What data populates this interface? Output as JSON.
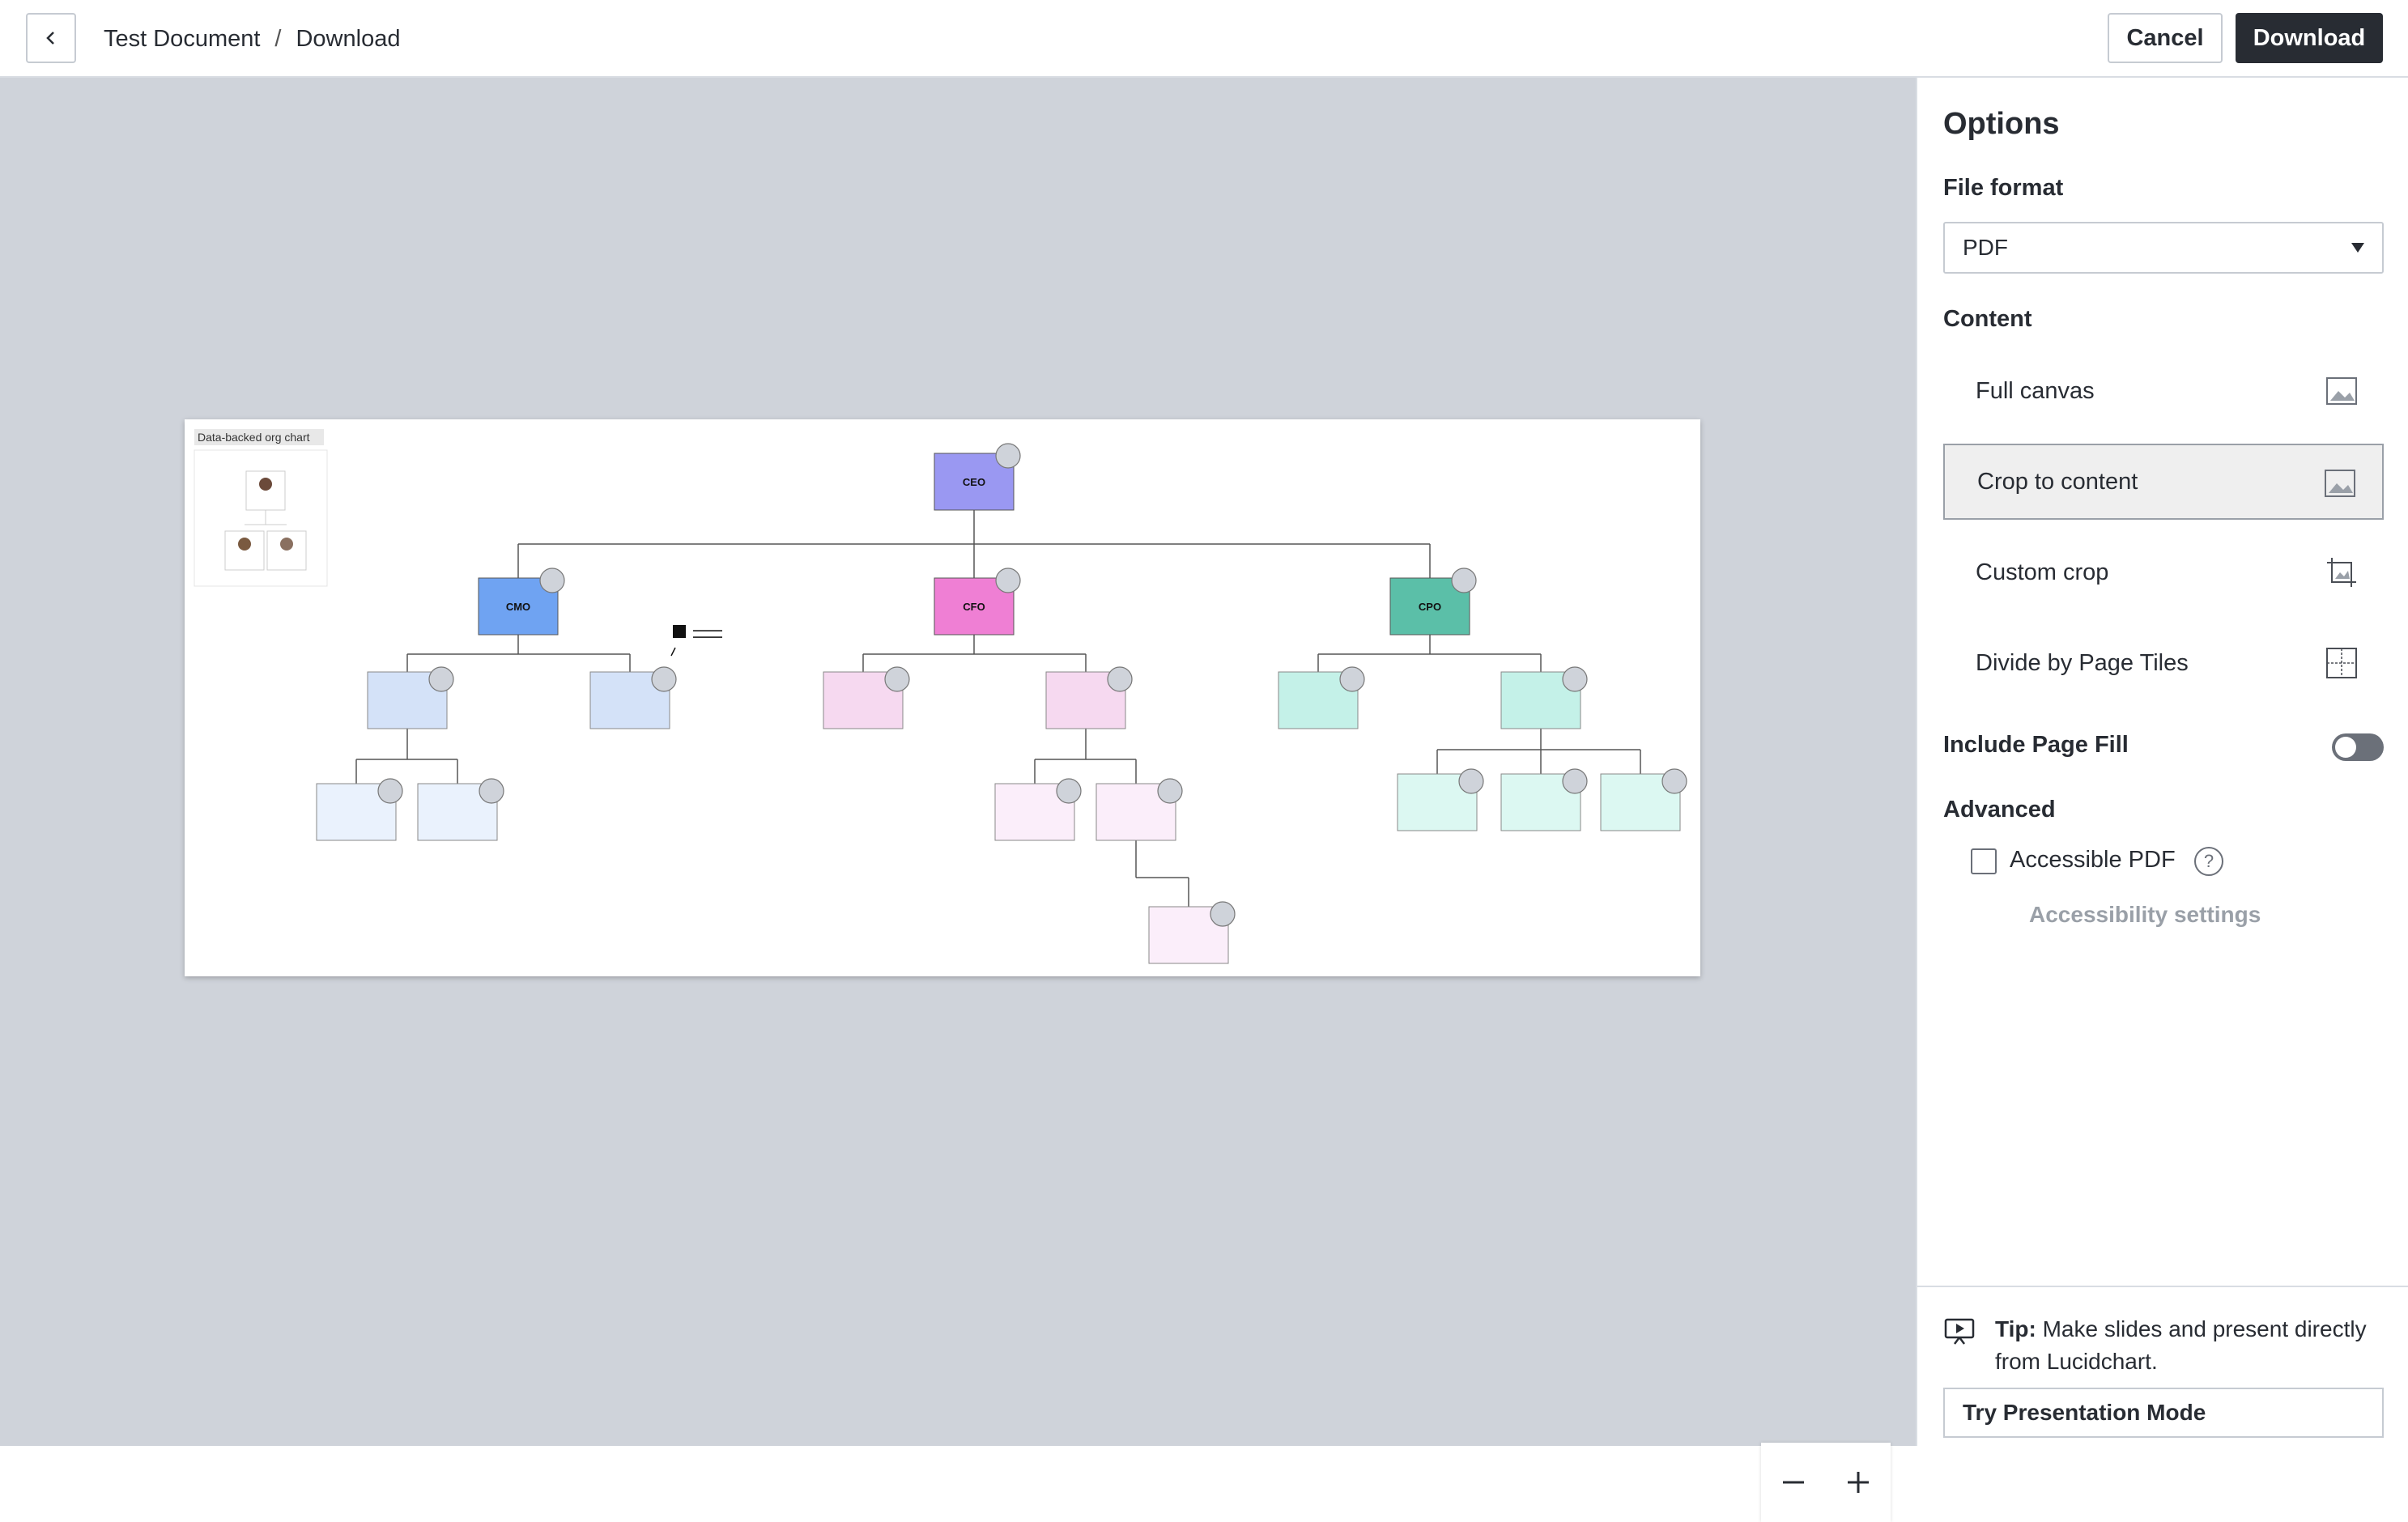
{
  "header": {
    "breadcrumb_doc": "Test Document",
    "breadcrumb_sep": "/",
    "breadcrumb_page": "Download",
    "cancel_label": "Cancel",
    "download_label": "Download"
  },
  "preview": {
    "thumb_title": "Data-backed org chart",
    "boxes": {
      "ceo": "CEO",
      "cmo": "CMO",
      "cfo": "CFO",
      "cpo": "CPO"
    }
  },
  "options": {
    "title": "Options",
    "file_format_label": "File format",
    "file_format_value": "PDF",
    "content_label": "Content",
    "content_options": [
      {
        "label": "Full canvas",
        "icon": "image-icon",
        "selected": false
      },
      {
        "label": "Crop to content",
        "icon": "image-icon",
        "selected": true
      },
      {
        "label": "Custom crop",
        "icon": "crop-icon",
        "selected": false
      },
      {
        "label": "Divide by Page Tiles",
        "icon": "page-tiles-icon",
        "selected": false
      }
    ],
    "include_page_fill_label": "Include Page Fill",
    "include_page_fill_on": false,
    "advanced_label": "Advanced",
    "accessible_pdf_label": "Accessible PDF",
    "accessible_pdf_checked": false,
    "accessibility_settings_label": "Accessibility settings"
  },
  "tip": {
    "bold": "Tip:",
    "text": " Make slides and present directly from Lucidchart.",
    "button_label": "Try Presentation Mode"
  },
  "colors": {
    "ceo": "#9a98f2",
    "cmo": "#6fa3f2",
    "cfo": "#ef7fd4",
    "cpo": "#5bbfa8",
    "cmo_light": "#d4e2f8",
    "cfo_light": "#f6d9f0",
    "cpo_light": "#c4f1e8"
  }
}
